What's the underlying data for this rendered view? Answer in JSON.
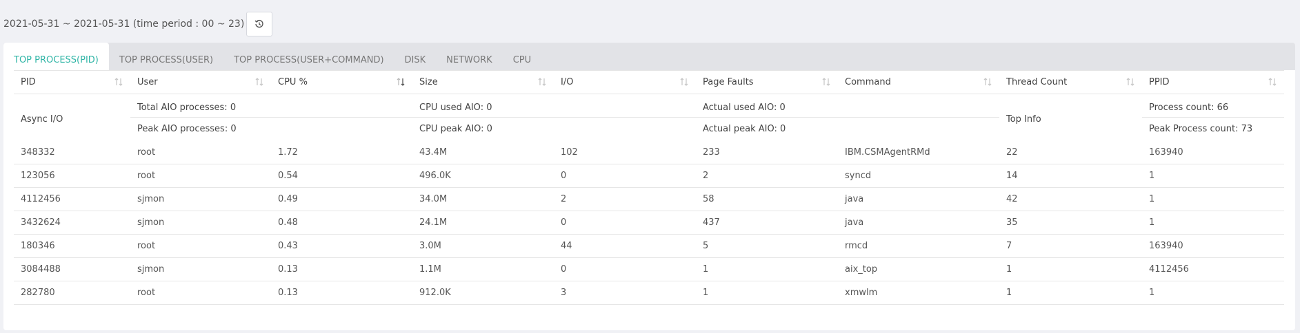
{
  "toolbar": {
    "date_range": "2021-05-31 ~ 2021-05-31 (time period : 00 ~ 23)",
    "refresh_icon": "history-icon"
  },
  "tabs": [
    {
      "label": "TOP PROCESS(PID)",
      "active": true
    },
    {
      "label": "TOP PROCESS(USER)",
      "active": false
    },
    {
      "label": "TOP PROCESS(USER+COMMAND)",
      "active": false
    },
    {
      "label": "DISK",
      "active": false
    },
    {
      "label": "NETWORK",
      "active": false
    },
    {
      "label": "CPU",
      "active": false
    }
  ],
  "summary": {
    "async_label": "Async I/O",
    "total_aio": "Total AIO processes: 0",
    "peak_aio": "Peak AIO processes: 0",
    "cpu_used_aio": "CPU used AIO: 0",
    "cpu_peak_aio": "CPU peak AIO: 0",
    "actual_used_aio": "Actual used AIO: 0",
    "actual_peak_aio": "Actual peak AIO: 0",
    "top_info_label": "Top Info",
    "process_count": "Process count: 66",
    "peak_process_count": "Peak Process count: 73"
  },
  "table": {
    "columns": [
      "PID",
      "User",
      "CPU %",
      "Size",
      "I/O",
      "Page Faults",
      "Command",
      "Thread Count",
      "PPID"
    ],
    "sorted_column": "CPU %",
    "rows": [
      [
        "348332",
        "root",
        "1.72",
        "43.4M",
        "102",
        "233",
        "IBM.CSMAgentRMd",
        "22",
        "163940"
      ],
      [
        "123056",
        "root",
        "0.54",
        "496.0K",
        "0",
        "2",
        "syncd",
        "14",
        "1"
      ],
      [
        "4112456",
        "sjmon",
        "0.49",
        "34.0M",
        "2",
        "58",
        "java",
        "42",
        "1"
      ],
      [
        "3432624",
        "sjmon",
        "0.48",
        "24.1M",
        "0",
        "437",
        "java",
        "35",
        "1"
      ],
      [
        "180346",
        "root",
        "0.43",
        "3.0M",
        "44",
        "5",
        "rmcd",
        "7",
        "163940"
      ],
      [
        "3084488",
        "sjmon",
        "0.13",
        "1.1M",
        "0",
        "1",
        "aix_top",
        "1",
        "4112456"
      ],
      [
        "282780",
        "root",
        "0.13",
        "912.0K",
        "3",
        "1",
        "xmwlm",
        "1",
        "1"
      ]
    ]
  },
  "colors": {
    "accent": "#2fb5a6",
    "background": "#f0f1f5",
    "tabbar": "#e2e3e7"
  }
}
